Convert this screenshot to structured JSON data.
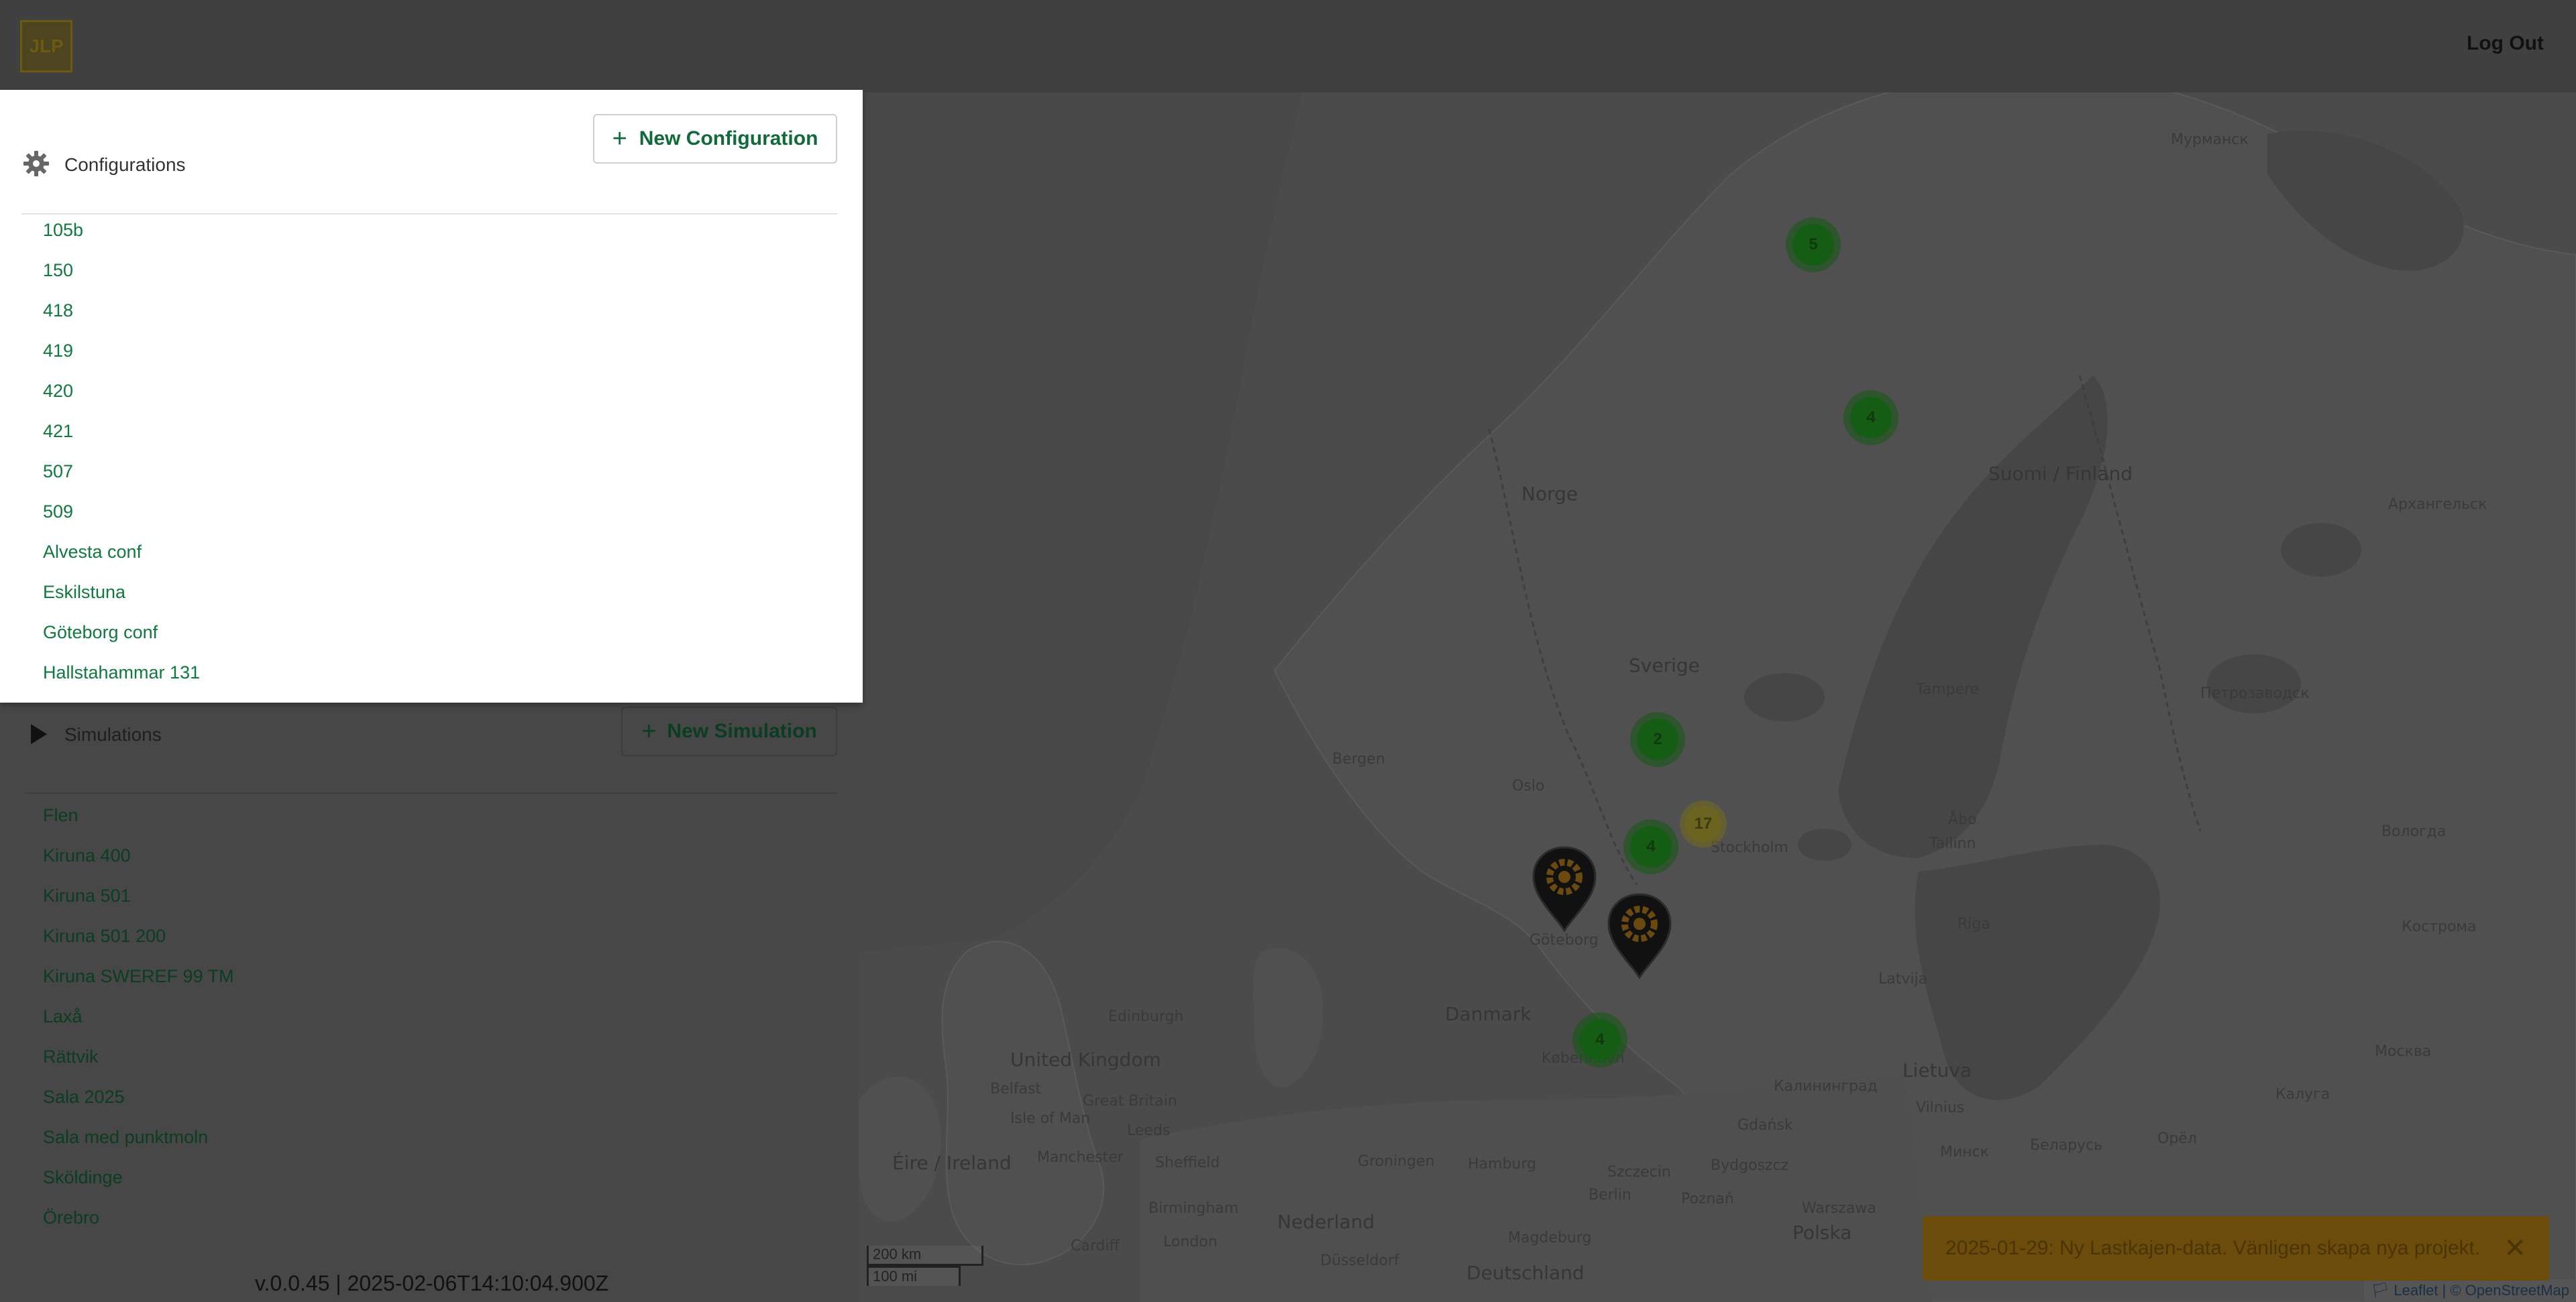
{
  "header": {
    "logo_text": "JLP",
    "logout_label": "Log Out"
  },
  "configurations": {
    "title": "Configurations",
    "new_button_label": "New Configuration",
    "items": [
      "105b",
      "150",
      "418",
      "419",
      "420",
      "421",
      "507",
      "509",
      "Alvesta conf",
      "Eskilstuna",
      "Göteborg conf",
      "Hallstahammar 131"
    ]
  },
  "simulations": {
    "title": "Simulations",
    "new_button_label": "New Simulation",
    "items": [
      "Flen",
      "Kiruna 400",
      "Kiruna 501",
      "Kiruna 501 200",
      "Kiruna SWEREF 99 TM",
      "Laxå",
      "Rättvik",
      "Sala 2025",
      "Sala med punktmoln",
      "Sköldinge",
      "Örebro"
    ]
  },
  "version": "v.0.0.45 | 2025-02-06T14:10:04.900Z",
  "map": {
    "clusters": [
      "5",
      "4",
      "2",
      "17",
      "4",
      "4"
    ],
    "labels": [
      "Мурманск",
      "Norge",
      "Suomi / Finland",
      "Архангельск",
      "Sverige",
      "Tampere",
      "Петрозаводск",
      "Bergen",
      "Oslo",
      "Stockholm",
      "Tallinn",
      "Вологда",
      "Göteborg",
      "Latvija",
      "Кострома",
      "Danmark",
      "Edinburgh",
      "United Kingdom",
      "Great Britain",
      "Isle of Man",
      "Belfast",
      "Leeds",
      "Manchester",
      "Éire / Ireland",
      "Sheffield",
      "Birmingham",
      "Cardiff",
      "London",
      "Hamburg",
      "Groningen",
      "Nederland",
      "Szczecin",
      "Gdańsk",
      "Bydgoszcz",
      "Lietuva",
      "Vilnius",
      "Минск",
      "Беларусь",
      "Warszawa",
      "Polska",
      "Berlin",
      "Poznań",
      "Magdeburg",
      "Deutschland",
      "Düsseldorf",
      "Москва",
      "Калуга",
      "Орёл",
      "Калининград",
      "Riga",
      "København",
      "Åbo"
    ],
    "scale_km": "200 km",
    "scale_mi": "100 mi",
    "attribution": "🏳 Leaflet | © OpenStreetMap"
  },
  "toast": {
    "message": "2025-01-29: Ny Lastkajen-data. Vänligen skapa nya projekt.",
    "close_icon": "close-icon"
  },
  "colors": {
    "accent_green": "#0f7a3d",
    "toast_bg": "#6b4c0a",
    "cluster_green": "#155c15",
    "cluster_yellow": "#6b6420",
    "pin_orange": "#6b4a10"
  }
}
